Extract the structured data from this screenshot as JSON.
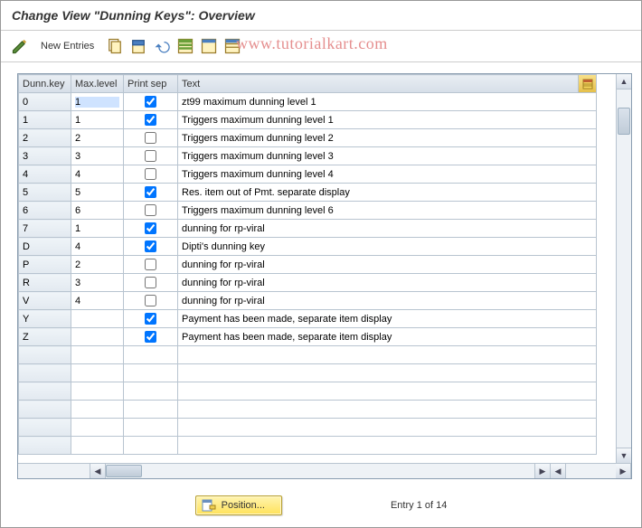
{
  "title": "Change View \"Dunning Keys\": Overview",
  "watermark": "www.tutorialkart.com",
  "toolbar": {
    "new_entries_label": "New Entries"
  },
  "columns": {
    "key": "Dunn.key",
    "level": "Max.level",
    "sep": "Print sep",
    "text": "Text"
  },
  "rows": [
    {
      "key": "0",
      "level": "1",
      "sep": true,
      "text": "zt99 maximum dunning level 1",
      "first": true
    },
    {
      "key": "1",
      "level": "1",
      "sep": true,
      "text": "Triggers maximum dunning level 1"
    },
    {
      "key": "2",
      "level": "2",
      "sep": false,
      "text": "Triggers maximum dunning level 2"
    },
    {
      "key": "3",
      "level": "3",
      "sep": false,
      "text": "Triggers maximum dunning level 3"
    },
    {
      "key": "4",
      "level": "4",
      "sep": false,
      "text": "Triggers maximum dunning level 4"
    },
    {
      "key": "5",
      "level": "5",
      "sep": true,
      "text": "Res. item out of Pmt. separate display"
    },
    {
      "key": "6",
      "level": "6",
      "sep": false,
      "text": "Triggers maximum dunning level 6"
    },
    {
      "key": "7",
      "level": "1",
      "sep": true,
      "text": "dunning for rp-viral"
    },
    {
      "key": "D",
      "level": "4",
      "sep": true,
      "text": "Dipti's dunning key"
    },
    {
      "key": "P",
      "level": "2",
      "sep": false,
      "text": "dunning for rp-viral"
    },
    {
      "key": "R",
      "level": "3",
      "sep": false,
      "text": "dunning for rp-viral"
    },
    {
      "key": "V",
      "level": "4",
      "sep": false,
      "text": "dunning for rp-viral"
    },
    {
      "key": "Y",
      "level": "",
      "sep": true,
      "text": "Payment has been made, separate item display"
    },
    {
      "key": "Z",
      "level": "",
      "sep": true,
      "text": "Payment has been made, separate item display"
    }
  ],
  "empty_rows": 6,
  "footer": {
    "position_label": "Position...",
    "entry_label": "Entry 1 of 14"
  }
}
